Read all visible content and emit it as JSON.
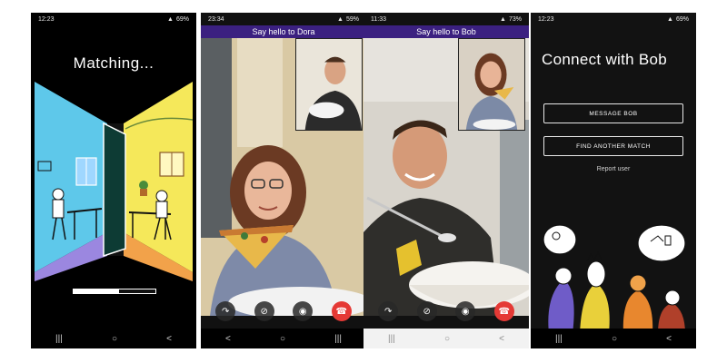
{
  "screens": [
    {
      "status": {
        "time": "12:23",
        "battery": "69%"
      },
      "title": "Matching...",
      "progress": 0.55
    },
    {
      "status": {
        "time": "23:34",
        "battery": "59%"
      },
      "header": "Say hello to Dora"
    },
    {
      "status": {
        "time": "11:33",
        "battery": "73%"
      },
      "header": "Say hello to Bob"
    },
    {
      "status": {
        "time": "12:23",
        "battery": "69%"
      },
      "title": "Connect with Bob",
      "message_button": "MESSAGE BOB",
      "find_button": "FIND ANOTHER MATCH",
      "report_link": "Report user"
    }
  ],
  "icons": {
    "nav": [
      "recents-icon",
      "home-icon",
      "back-icon"
    ],
    "call": [
      "share-icon",
      "mute-icon",
      "camera-icon",
      "end-call-icon"
    ]
  },
  "colors": {
    "header_purple": "#3b2080",
    "end_call_red": "#e53935",
    "scene_blue": "#5ec8ea",
    "scene_yellow": "#f5e85a",
    "scene_purple": "#9b87e0",
    "scene_orange": "#f2a24a"
  }
}
